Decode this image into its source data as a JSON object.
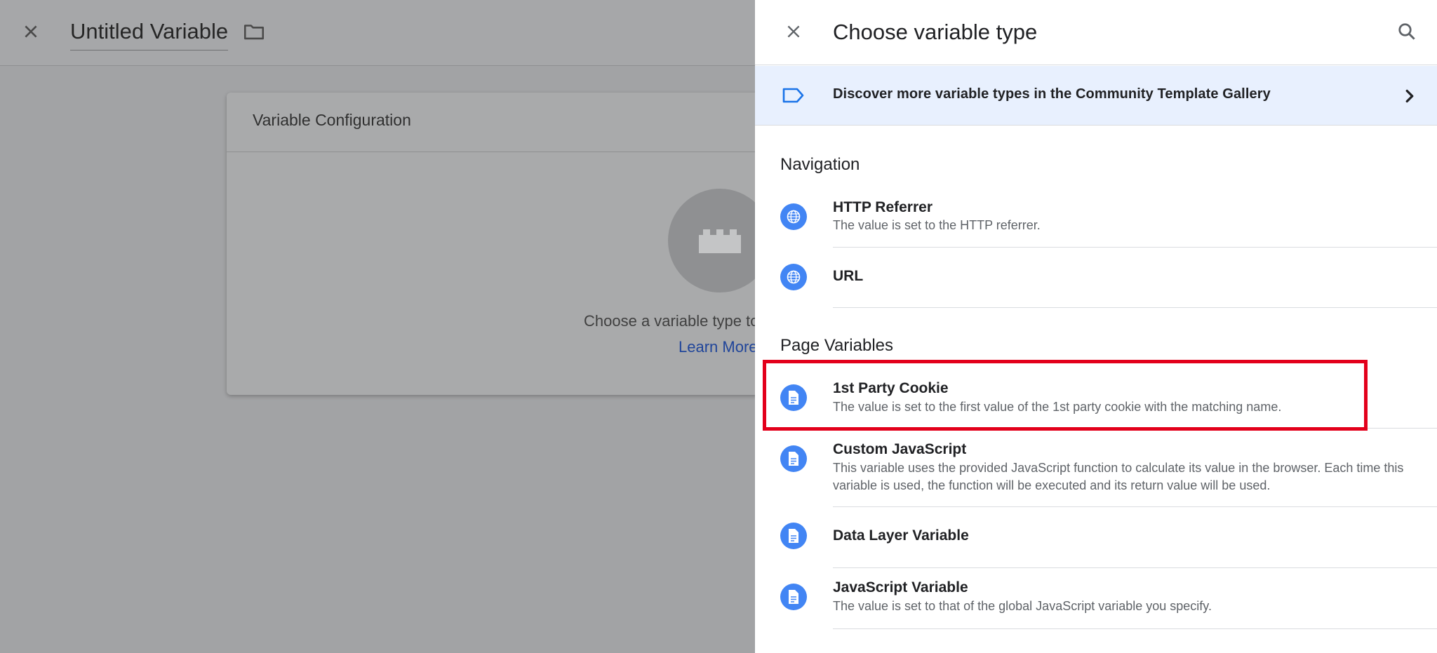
{
  "background_editor": {
    "title": "Untitled Variable",
    "card_title": "Variable Configuration",
    "hint_text": "Choose a variable type to",
    "learn_more": "Learn More"
  },
  "panel": {
    "title": "Choose variable type",
    "gallery_banner": "Discover more variable types in the Community Template Gallery",
    "sections": [
      {
        "heading": "Navigation",
        "items": [
          {
            "name": "HTTP Referrer",
            "description": "The value is set to the HTTP referrer.",
            "icon": "globe-icon"
          },
          {
            "name": "URL",
            "description": "",
            "icon": "globe-icon"
          }
        ]
      },
      {
        "heading": "Page Variables",
        "items": [
          {
            "name": "1st Party Cookie",
            "description": "The value is set to the first value of the 1st party cookie with the matching name.",
            "icon": "document-icon",
            "highlighted": true
          },
          {
            "name": "Custom JavaScript",
            "description": "This variable uses the provided JavaScript function to calculate its value in the browser. Each time this variable is used, the function will be executed and its return value will be used.",
            "icon": "document-icon"
          },
          {
            "name": "Data Layer Variable",
            "description": "",
            "icon": "document-icon"
          },
          {
            "name": "JavaScript Variable",
            "description": "The value is set to that of the global JavaScript variable you specify.",
            "icon": "document-icon"
          }
        ]
      }
    ]
  },
  "colors": {
    "accent_blue": "#4285f4",
    "banner_bg": "#e8f0fe",
    "highlight_red": "#e3001b",
    "overlay_gray": "#a2a3a5"
  }
}
